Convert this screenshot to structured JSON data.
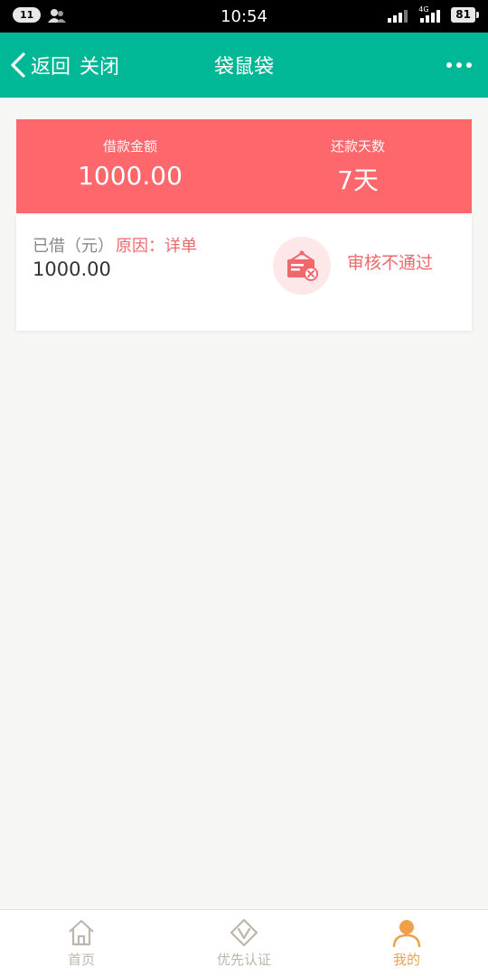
{
  "status_bar": {
    "notification_count": "11",
    "time": "10:54",
    "network_type": "4G",
    "battery": "81"
  },
  "nav": {
    "back_label": "返回",
    "close_label": "关闭",
    "title": "袋鼠袋"
  },
  "summary": {
    "loan_amount_label": "借款金额",
    "loan_amount_value": "1000.00",
    "repay_days_label": "还款天数",
    "repay_days_value": "7天"
  },
  "record": {
    "borrowed_label": "已借（元）",
    "reason_link": "原因：详单",
    "amount": "1000.00",
    "status": "审核不通过"
  },
  "tab_bar": {
    "tabs": [
      {
        "label": "首页",
        "icon": "home-icon"
      },
      {
        "label": "优先认证",
        "icon": "v-badge-icon"
      },
      {
        "label": "我的",
        "icon": "person-icon",
        "active": true
      }
    ]
  },
  "colors": {
    "nav_green": "#00b896",
    "banner_red": "#fe676c",
    "status_red": "#f0686c",
    "tab_active": "#f0a04b",
    "tab_inactive": "#bfb6ab"
  }
}
